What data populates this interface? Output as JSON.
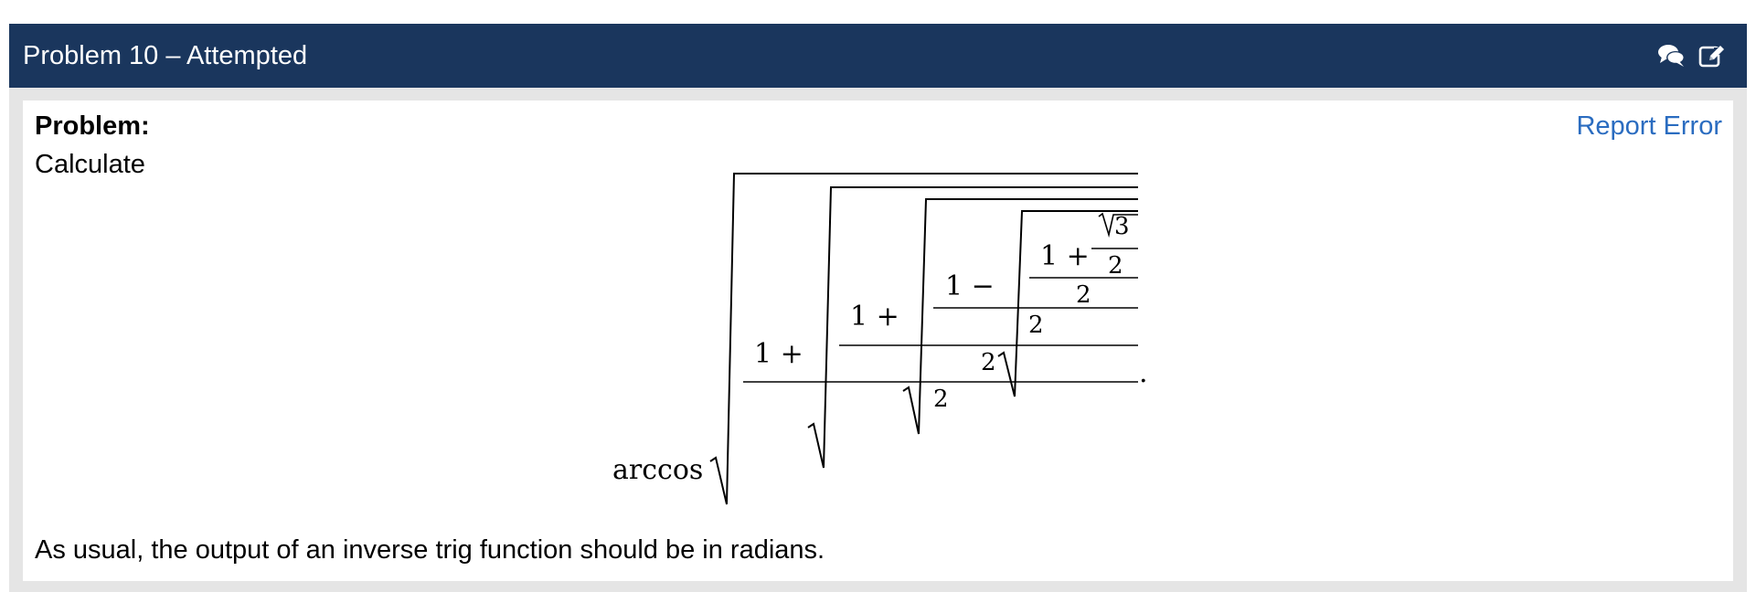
{
  "header": {
    "title": "Problem 10 – Attempted",
    "icons": [
      "comments-icon",
      "edit-icon"
    ],
    "background_color": "#1a365d"
  },
  "problem": {
    "label": "Problem:",
    "report_error": "Report Error",
    "link_color": "#2a6cc0",
    "intro": "Calculate",
    "outro": "As usual, the output of an inverse trig function should be in radians."
  },
  "formula": {
    "function": "arccos",
    "terms": {
      "t1": "1 +",
      "t2": "1 +",
      "t3": "1 −",
      "t4": "1 +",
      "root3": "3"
    },
    "denominators": {
      "d1": "2",
      "d2": "2",
      "d3": "2",
      "d4": "2",
      "d5": "2"
    },
    "period": "."
  }
}
